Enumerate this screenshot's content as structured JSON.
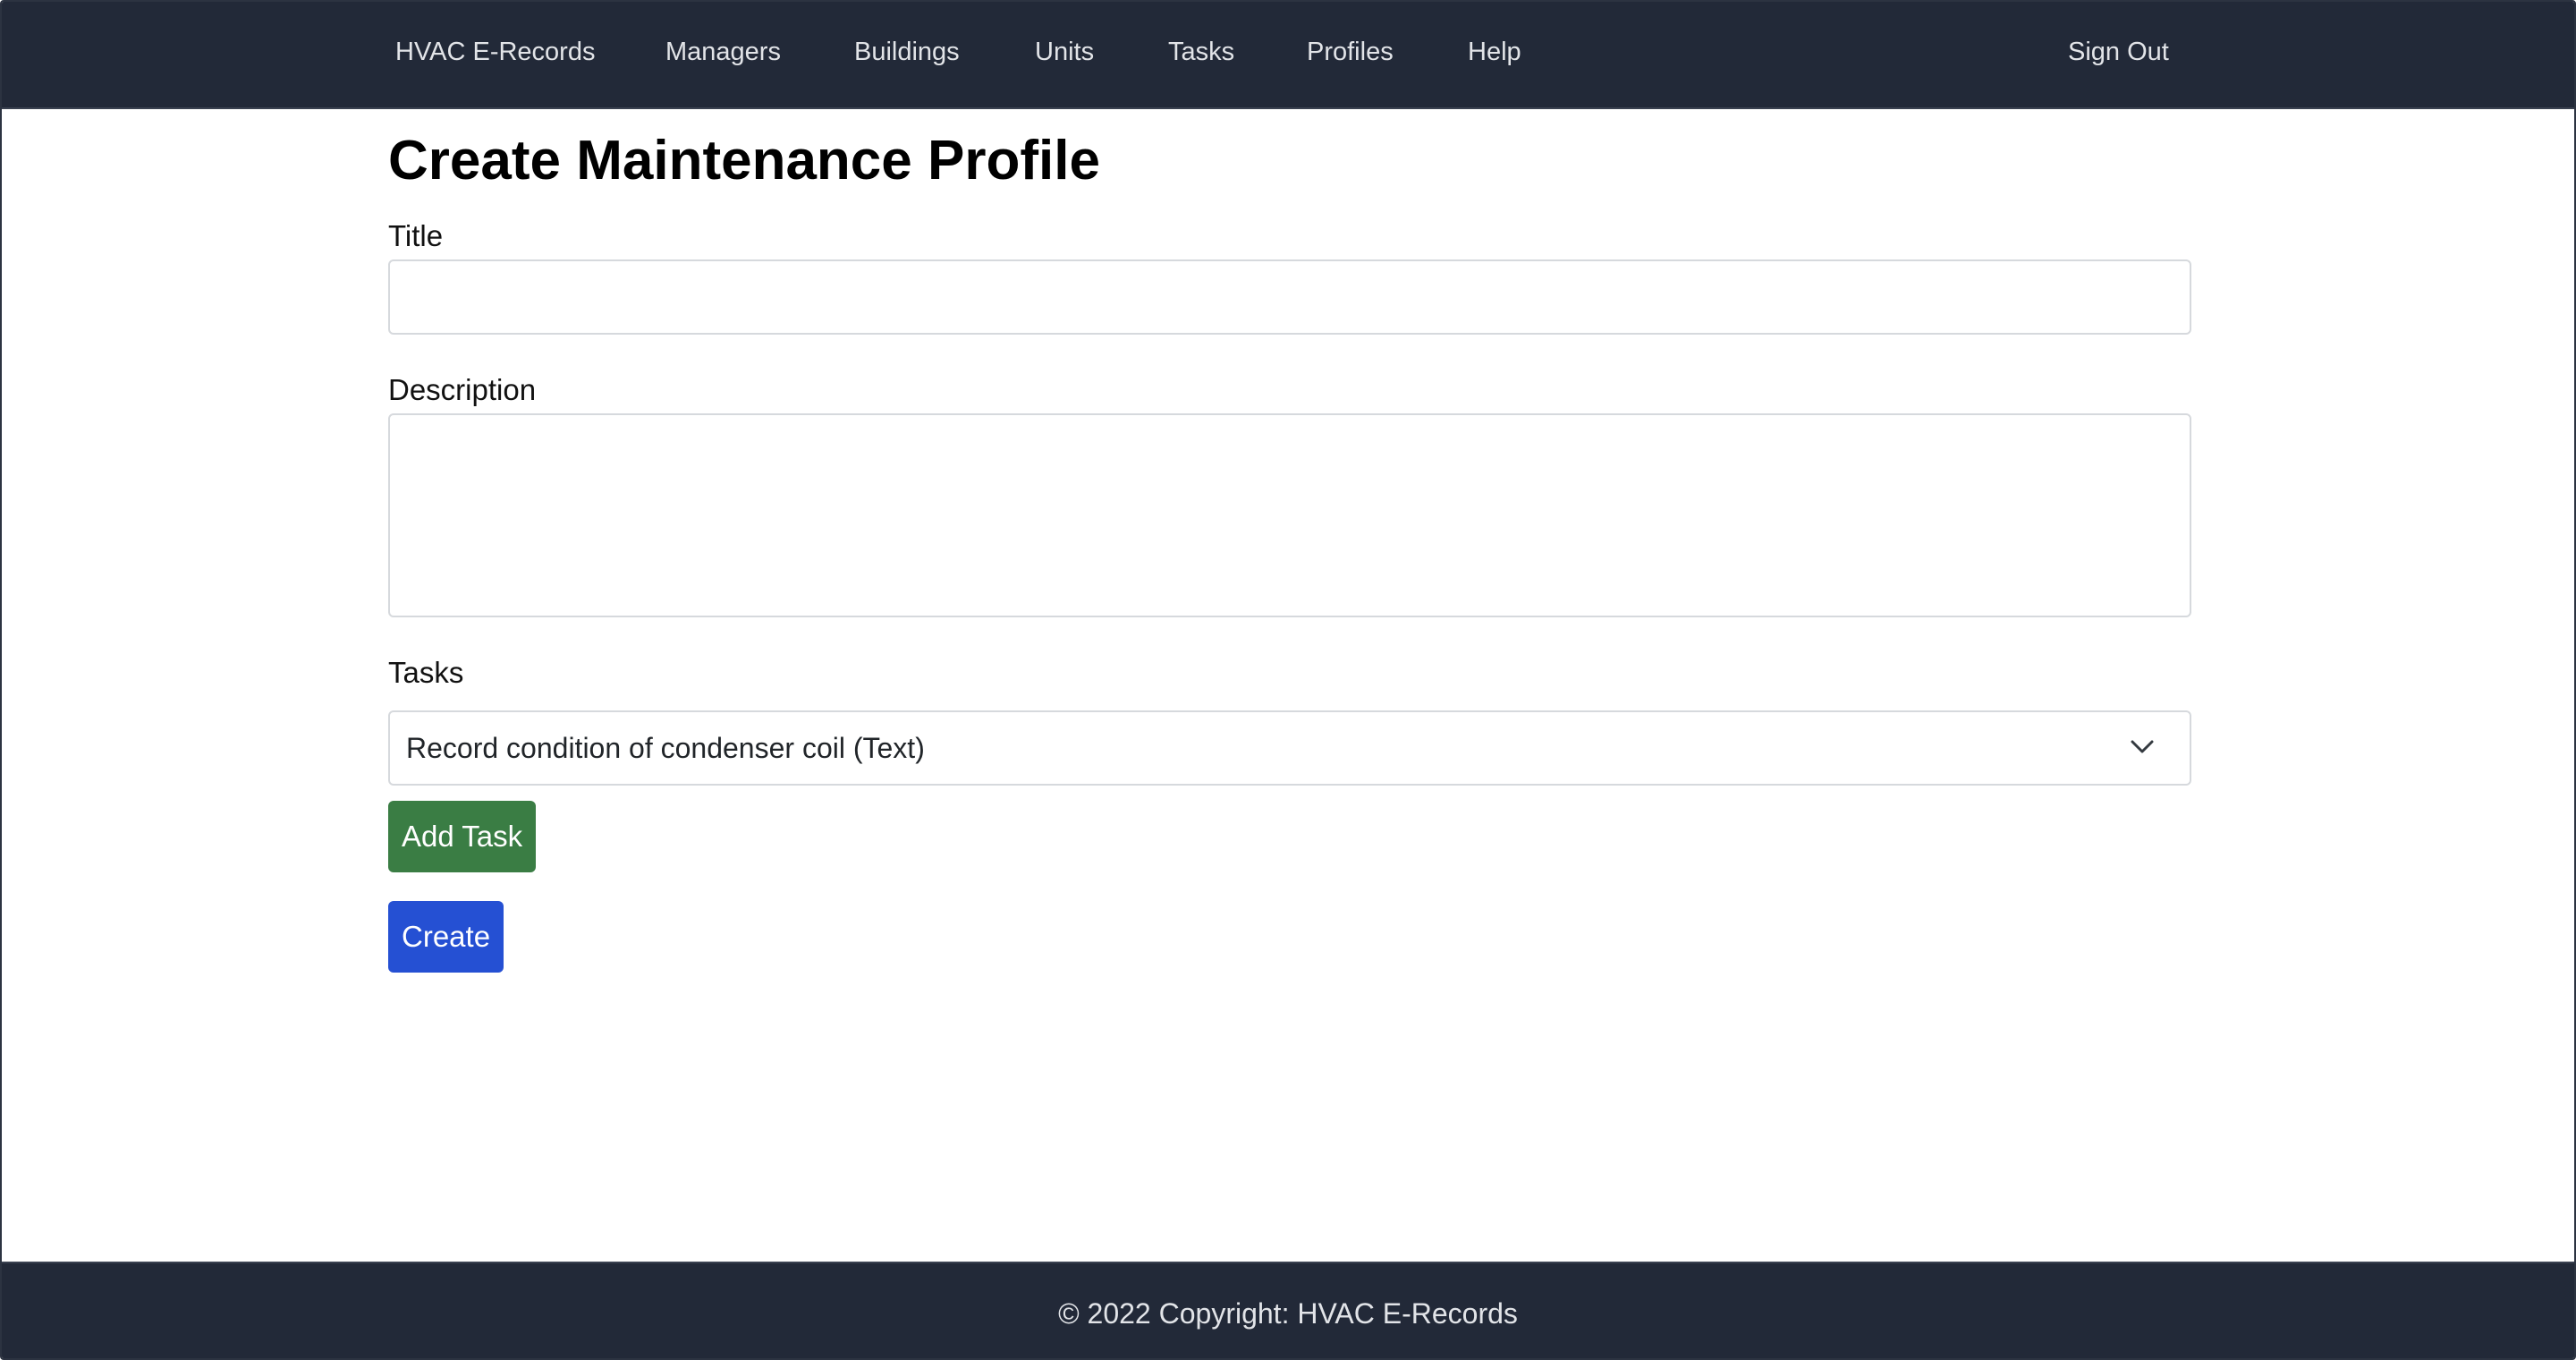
{
  "navbar": {
    "brand": "HVAC E-Records",
    "links": [
      "Managers",
      "Buildings",
      "Units",
      "Tasks",
      "Profiles",
      "Help"
    ],
    "sign_out": "Sign Out"
  },
  "page": {
    "title": "Create Maintenance Profile"
  },
  "form": {
    "title_label": "Title",
    "title_value": "",
    "description_label": "Description",
    "description_value": "",
    "tasks_label": "Tasks",
    "tasks_selected": "Record condition of condenser coil (Text)",
    "add_task_label": "Add Task",
    "create_label": "Create"
  },
  "footer": {
    "text": "© 2022 Copyright: HVAC E-Records"
  },
  "colors": {
    "navbar_bg": "#222938",
    "success": "#3a7d44",
    "primary": "#2550d3"
  },
  "icons": {
    "select_arrow": "chevron-down-icon"
  }
}
